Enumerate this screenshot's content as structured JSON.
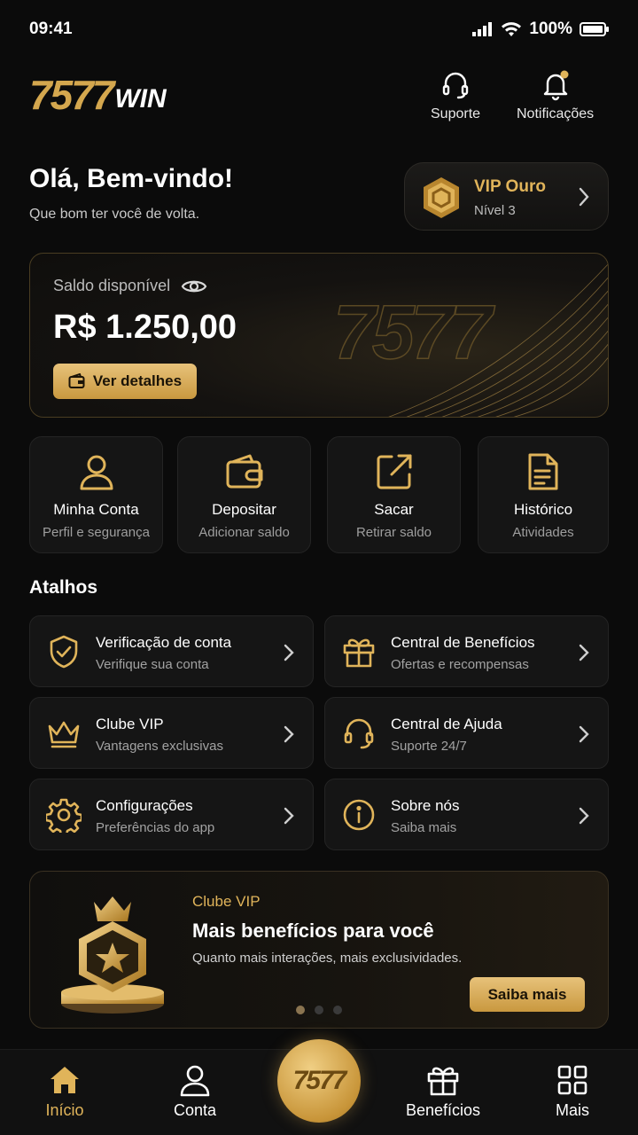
{
  "status_bar": {
    "time": "09:41",
    "battery": "100%"
  },
  "header": {
    "logo_number": "7577",
    "logo_suffix": "WIN",
    "support_label": "Suporte",
    "notifications_label": "Notificações"
  },
  "greeting": {
    "title": "Olá, Bem-vindo!",
    "subtitle": "Que bom ter você de volta."
  },
  "vip": {
    "name": "VIP Ouro",
    "level": "Nível 3"
  },
  "balance": {
    "label": "Saldo disponível",
    "value": "R$ 1.250,00",
    "details_button": "Ver detalhes",
    "watermark": "7577"
  },
  "quick_actions": [
    {
      "title": "Minha Conta",
      "subtitle": "Perfil e segurança",
      "icon": "user-icon"
    },
    {
      "title": "Depositar",
      "subtitle": "Adicionar saldo",
      "icon": "wallet-icon"
    },
    {
      "title": "Sacar",
      "subtitle": "Retirar saldo",
      "icon": "withdraw-icon"
    },
    {
      "title": "Histórico",
      "subtitle": "Atividades",
      "icon": "document-icon"
    }
  ],
  "shortcuts_title": "Atalhos",
  "shortcuts": [
    {
      "title": "Verificação de conta",
      "subtitle": "Verifique sua conta",
      "icon": "shield-check-icon"
    },
    {
      "title": "Central de Benefícios",
      "subtitle": "Ofertas e recompensas",
      "icon": "gift-icon"
    },
    {
      "title": "Clube VIP",
      "subtitle": "Vantagens exclusivas",
      "icon": "crown-icon"
    },
    {
      "title": "Central de Ajuda",
      "subtitle": "Suporte 24/7",
      "icon": "headset-icon"
    },
    {
      "title": "Configurações",
      "subtitle": "Preferências do app",
      "icon": "gear-icon"
    },
    {
      "title": "Sobre nós",
      "subtitle": "Saiba mais",
      "icon": "info-icon"
    }
  ],
  "banner": {
    "tag": "Clube VIP",
    "title": "Mais benefícios para você",
    "subtitle": "Quanto mais interações, mais exclusividades.",
    "button": "Saiba mais"
  },
  "bottom_nav": {
    "items": [
      {
        "label": "Início",
        "icon": "home-icon",
        "active": true
      },
      {
        "label": "Conta",
        "icon": "user-icon",
        "active": false
      },
      {
        "label": "Benefícios",
        "icon": "gift-icon",
        "active": false
      },
      {
        "label": "Mais",
        "icon": "grid-icon",
        "active": false
      }
    ],
    "center_label": "7577"
  },
  "colors": {
    "accent": "#e0b45a",
    "background": "#0b0b0b",
    "card": "#151515"
  }
}
